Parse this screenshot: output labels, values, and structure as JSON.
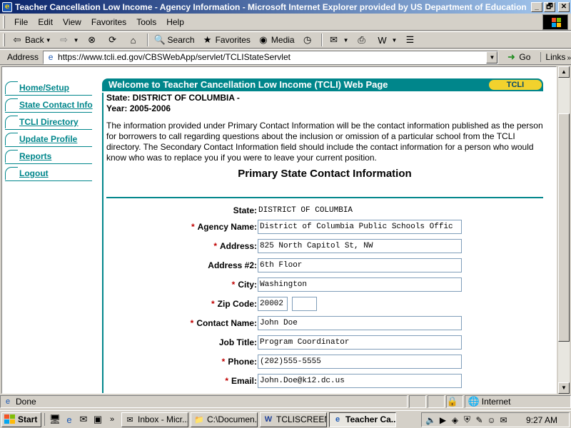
{
  "window": {
    "title": "Teacher Cancellation Low Income - Agency Information - Microsoft Internet Explorer provided by US Department of Education",
    "minimize": "_",
    "maximize": "🗗",
    "close": "✕"
  },
  "menu": [
    "File",
    "Edit",
    "View",
    "Favorites",
    "Tools",
    "Help"
  ],
  "toolbar": {
    "back": "Back",
    "search": "Search",
    "favorites": "Favorites",
    "media": "Media"
  },
  "address": {
    "label": "Address",
    "url": "https://www.tcli.ed.gov/CBSWebApp/servlet/TCLIStateServlet",
    "go": "Go",
    "links": "Links"
  },
  "nav": [
    {
      "label": "Home/Setup"
    },
    {
      "label": "State Contact Info"
    },
    {
      "label": "TCLI Directory"
    },
    {
      "label": "Update Profile"
    },
    {
      "label": "Reports"
    },
    {
      "label": "Logout"
    }
  ],
  "panel": {
    "header": "Welcome to Teacher Cancellation Low Income (TCLI) Web Page",
    "tag": "TCLI",
    "state_line": "State: DISTRICT OF COLUMBIA -",
    "year_line": "Year: 2005-2006",
    "intro": "The information provided under Primary Contact Information will be the contact information published as the person for borrowers to call regarding questions about the inclusion or omission of a particular school from the TCLI directory. The Secondary Contact Information field should include the contact information for a person who would know who was to replace you if you were to leave your current position.",
    "section_title": "Primary State Contact Information"
  },
  "form": {
    "state": {
      "label": "State:",
      "value": "DISTRICT OF COLUMBIA"
    },
    "agency_name": {
      "label": "Agency Name:",
      "value": "District of Columbia Public Schools Offic",
      "required": "*"
    },
    "address": {
      "label": "Address:",
      "value": "825 North Capitol St, NW",
      "required": "*"
    },
    "address2": {
      "label": "Address #2:",
      "value": "6th Floor"
    },
    "city": {
      "label": "City:",
      "value": "Washington",
      "required": "*"
    },
    "zip": {
      "label": "Zip Code:",
      "value": "20002",
      "ext": "",
      "required": "*"
    },
    "contact_name": {
      "label": "Contact Name:",
      "value": "John Doe",
      "required": "*"
    },
    "job_title": {
      "label": "Job Title:",
      "value": "Program Coordinator"
    },
    "phone": {
      "label": "Phone:",
      "value": "(202)555-5555",
      "required": "*"
    },
    "email": {
      "label": "Email:",
      "value": "John.Doe@k12.dc.us",
      "required": "*"
    }
  },
  "status": {
    "text": "Done",
    "zone": "Internet"
  },
  "taskbar": {
    "start": "Start",
    "tasks": [
      {
        "label": "Inbox - Micr..."
      },
      {
        "label": "C:\\Documen..."
      },
      {
        "label": "TCLISCREEN..."
      },
      {
        "label": "Teacher Ca..."
      }
    ],
    "clock": "9:27 AM"
  },
  "colors": {
    "accent": "#00868b",
    "tag": "#f2d22d",
    "required": "#c00000"
  }
}
